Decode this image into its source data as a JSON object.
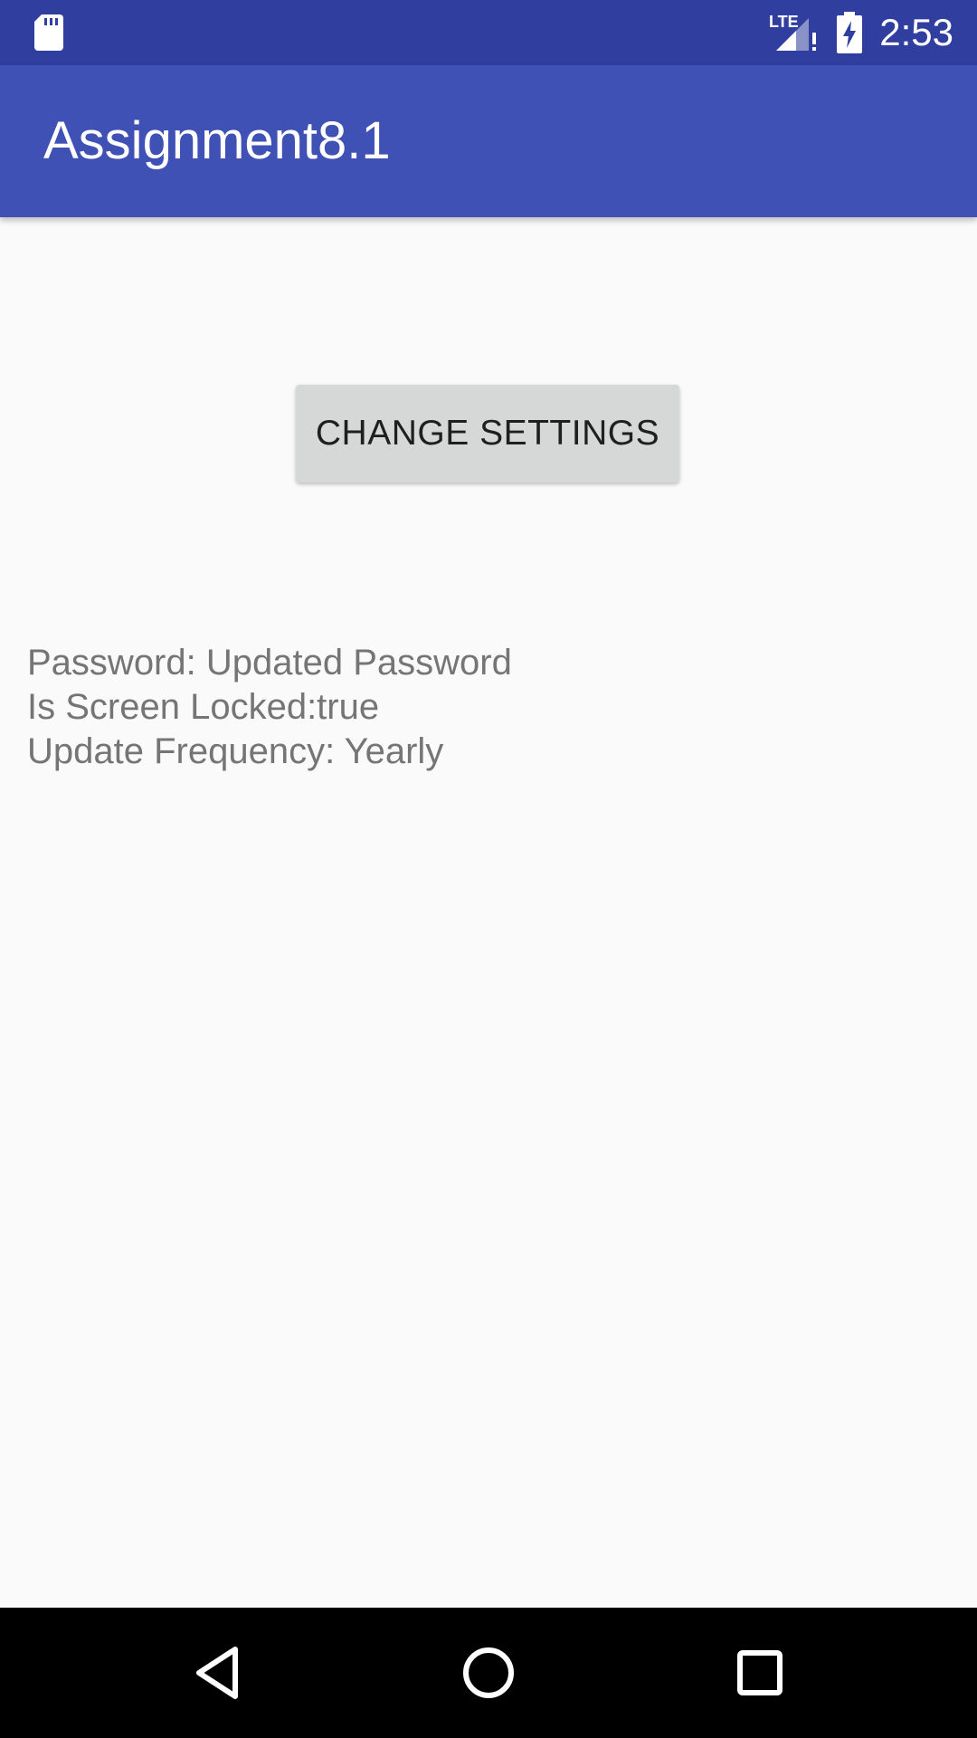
{
  "status_bar": {
    "network": "LTE",
    "time": "2:53"
  },
  "app_bar": {
    "title": "Assignment8.1"
  },
  "main": {
    "change_settings_label": "CHANGE SETTINGS",
    "info_lines": {
      "password": "Password: Updated Password",
      "screen_locked": "Is Screen Locked:true",
      "update_frequency": "Update Frequency: Yearly"
    }
  },
  "colors": {
    "status_bar": "#303f9f",
    "app_bar": "#3f51b5",
    "background": "#fafafa",
    "button": "#d6d7d7",
    "info_text": "#757575",
    "nav_bar": "#000000"
  },
  "icons": {
    "status_left": "sd-card-icon",
    "status_signal": "lte-signal-icon",
    "status_battery": "battery-charging-icon",
    "nav_back": "back-icon",
    "nav_home": "home-icon",
    "nav_recents": "recents-icon"
  }
}
